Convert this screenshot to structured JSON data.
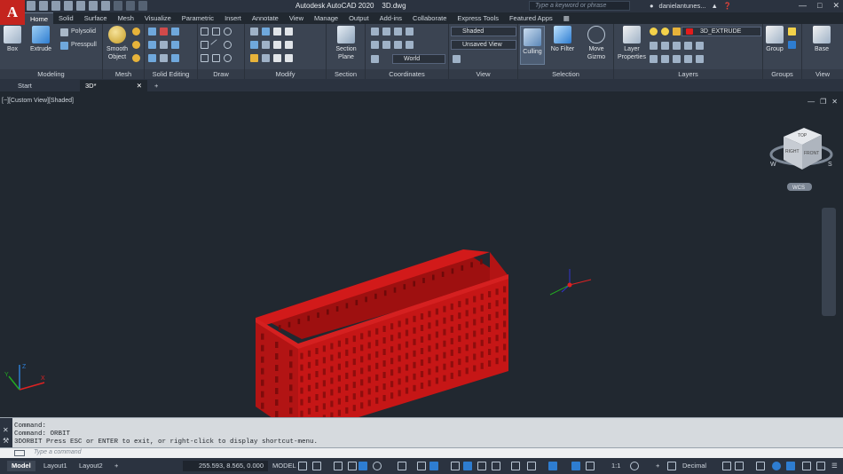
{
  "app": {
    "title": "Autodesk AutoCAD 2020",
    "file": "3D.dwg",
    "logo": "A",
    "search_placeholder": "Type a keyword or phrase",
    "user": "danielantunes..."
  },
  "ribbon_tabs": [
    "Home",
    "Solid",
    "Surface",
    "Mesh",
    "Visualize",
    "Parametric",
    "Insert",
    "Annotate",
    "View",
    "Manage",
    "Output",
    "Add-ins",
    "Collaborate",
    "Express Tools",
    "Featured Apps"
  ],
  "panels": {
    "modeling": {
      "title": "Modeling",
      "box": "Box",
      "extrude": "Extrude",
      "polysolid": "Polysolid",
      "presspull": "Presspull"
    },
    "mesh": {
      "title": "Mesh",
      "smooth": "Smooth",
      "object": "Object"
    },
    "solid_editing": {
      "title": "Solid Editing"
    },
    "draw": {
      "title": "Draw"
    },
    "modify": {
      "title": "Modify"
    },
    "section": {
      "title": "Section",
      "section_label": "Section",
      "plane_label": "Plane"
    },
    "coordinates": {
      "title": "Coordinates",
      "ucs_value": "World"
    },
    "view": {
      "title": "View",
      "visual_style": "Shaded",
      "named_view": "Unsaved View"
    },
    "selection": {
      "title": "Selection",
      "culling": "Culling",
      "no_filter": "No Filter",
      "move": "Move",
      "gizmo": "Gizmo"
    },
    "layers": {
      "title": "Layers",
      "layer_props_1": "Layer",
      "layer_props_2": "Properties",
      "current_layer": "3D_EXTRUDE"
    },
    "groups": {
      "title": "Groups",
      "group": "Group"
    },
    "view2": {
      "title": "View",
      "base": "Base"
    }
  },
  "doc_tabs": {
    "start": "Start",
    "active": "3D*",
    "new": "+"
  },
  "viewport": {
    "label": "[−][Custom View][Shaded]",
    "viewcube": {
      "top": "TOP",
      "front": "FRONT",
      "right": "RIGHT",
      "wcs": "WCS",
      "s": "S",
      "w": "W"
    }
  },
  "command": {
    "lines": [
      "Command:",
      "Command: ORBIT",
      "3DORBIT Press ESC or ENTER to exit, or right-click to display shortcut-menu."
    ],
    "placeholder": "Type a command"
  },
  "status": {
    "tabs": [
      "Model",
      "Layout1",
      "Layout2"
    ],
    "coords": "255.593, 8.565, 0.000",
    "space": "MODEL",
    "scale": "1:1",
    "units": "Decimal"
  },
  "colors": {
    "object": "#c61616",
    "object_dark": "#8f0d0d",
    "object_side": "#a91212",
    "accent": "#2e7dd1"
  }
}
